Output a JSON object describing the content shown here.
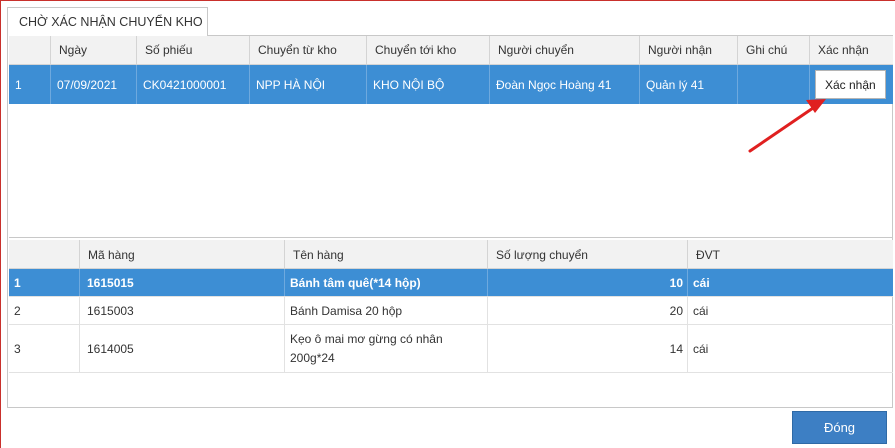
{
  "tab": {
    "title": "CHỜ XÁC NHẬN CHUYỂN KHO"
  },
  "transfers": {
    "columns": [
      "",
      "Ngày",
      "Số phiếu",
      "Chuyển từ kho",
      "Chuyển tới kho",
      "Người chuyển",
      "Người nhận",
      "Ghi chú",
      "Xác nhận"
    ],
    "rows": [
      {
        "stt": "1",
        "date": "07/09/2021",
        "ticket": "CK0421000001",
        "from": "NPP HÀ NỘI",
        "to": "KHO NỘI BỘ",
        "sender": "Đoàn Ngọc Hoàng 41",
        "receiver": "Quản lý 41",
        "note": "",
        "confirm_label": "Xác nhận"
      }
    ]
  },
  "items": {
    "columns": [
      "",
      "Mã hàng",
      "Tên hàng",
      "Số lượng chuyển",
      "ĐVT"
    ],
    "rows": [
      {
        "stt": "1",
        "code": "1615015",
        "name": "Bánh tâm quê(*14 hộp)",
        "qty": "10",
        "unit": "cái"
      },
      {
        "stt": "2",
        "code": "1615003",
        "name": "Bánh Damisa 20 hộp",
        "qty": "20",
        "unit": "cái"
      },
      {
        "stt": "3",
        "code": "1614005",
        "name": "Kẹo ô mai mơ gừng có nhân 200g*24",
        "qty": "14",
        "unit": "cái"
      }
    ]
  },
  "footer": {
    "close_label": "Đóng"
  },
  "colors": {
    "selected_row": "#3d8ed4",
    "arrow": "#e02020",
    "button": "#3d7fc4"
  }
}
